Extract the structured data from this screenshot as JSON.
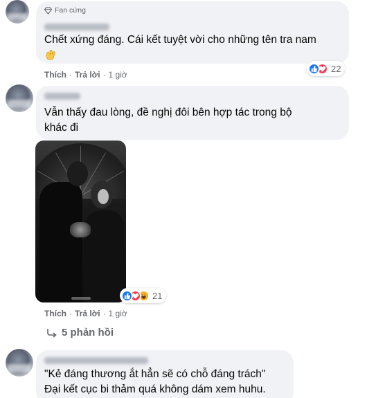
{
  "comments": [
    {
      "badge": "Fan cứng",
      "text_lines": [
        "Chết xứng đáng. Cái kết tuyệt vời cho những tên tra nam"
      ],
      "emoji": "clap-hands",
      "actions": {
        "like": "Thích",
        "reply": "Trả lời",
        "separator": "·",
        "time": "1 giờ"
      },
      "reactions": {
        "types": [
          "like",
          "love"
        ],
        "count": "22"
      }
    },
    {
      "text_lines": [
        "Vẫn thấy đau lòng, đề nghị đôi bên hợp tác trong bộ",
        "khác đi"
      ],
      "attachment": "photo-couple-umbrella",
      "actions": {
        "like": "Thích",
        "reply": "Trả lời",
        "separator": "·",
        "time": "1 giờ"
      },
      "reactions": {
        "types": [
          "like",
          "love",
          "haha"
        ],
        "count": "21"
      },
      "view_replies": "5 phản hồi"
    },
    {
      "text_lines": [
        "\"Kẻ đáng thương ắt hẳn sẽ có chỗ đáng trách\"",
        "Đại kết cục bi thảm quá không dám xem huhu."
      ]
    }
  ],
  "colors": {
    "bubble": "#f0f2f5",
    "meta_text": "#65676b",
    "like_blue": "#1877f2",
    "love_red": "#f33e58",
    "haha_yellow": "#f7b125"
  }
}
